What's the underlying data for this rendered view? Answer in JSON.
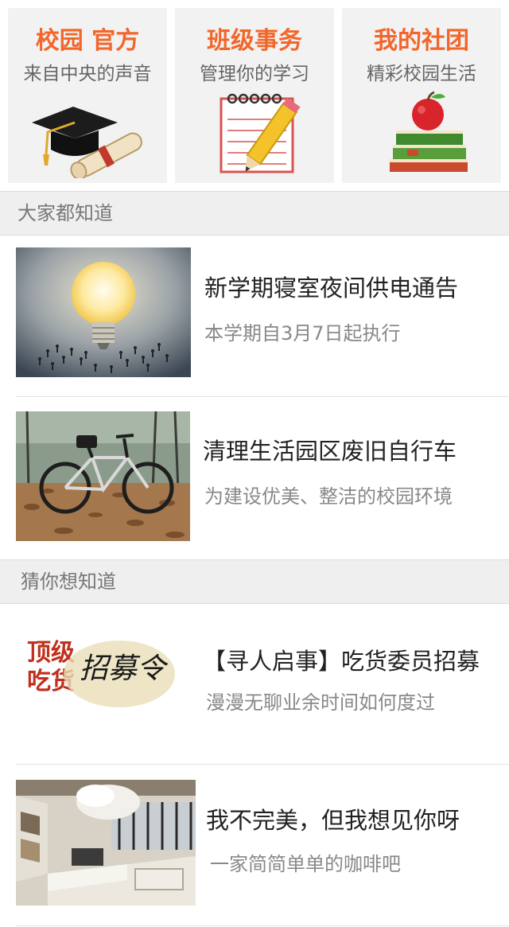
{
  "tiles": [
    {
      "title": "校园 官方",
      "subtitle": "来自中央的声音",
      "icon": "graduation-cap-icon"
    },
    {
      "title": "班级事务",
      "subtitle": "管理你的学习",
      "icon": "notepad-pencil-icon"
    },
    {
      "title": "我的社团",
      "subtitle": "精彩校园生活",
      "icon": "apple-books-icon"
    }
  ],
  "section1": {
    "title": "大家都知道",
    "items": [
      {
        "title": "新学期寝室夜间供电通告",
        "desc": "本学期自3月7日起执行",
        "thumb": "lightbulb-crowd"
      },
      {
        "title": "清理生活园区废旧自行车",
        "desc": "为建设优美、整洁的校园环境",
        "thumb": "bicycle-leaves"
      }
    ]
  },
  "section2": {
    "title": "猜你想知道",
    "items": [
      {
        "title": "【寻人启事】吃货委员招募",
        "desc": "漫漫无聊业余时间如何度过",
        "thumb": "recruit-calligraphy",
        "thumb_text": {
          "left1": "顶级",
          "left2": "吃货",
          "brush": "招募令"
        }
      },
      {
        "title": "我不完美，但我想见你呀",
        "desc": "一家简简单单的咖啡吧",
        "thumb": "cafe-interior"
      }
    ]
  },
  "colors": {
    "accent": "#f2662a",
    "section_bg": "#efefef"
  }
}
